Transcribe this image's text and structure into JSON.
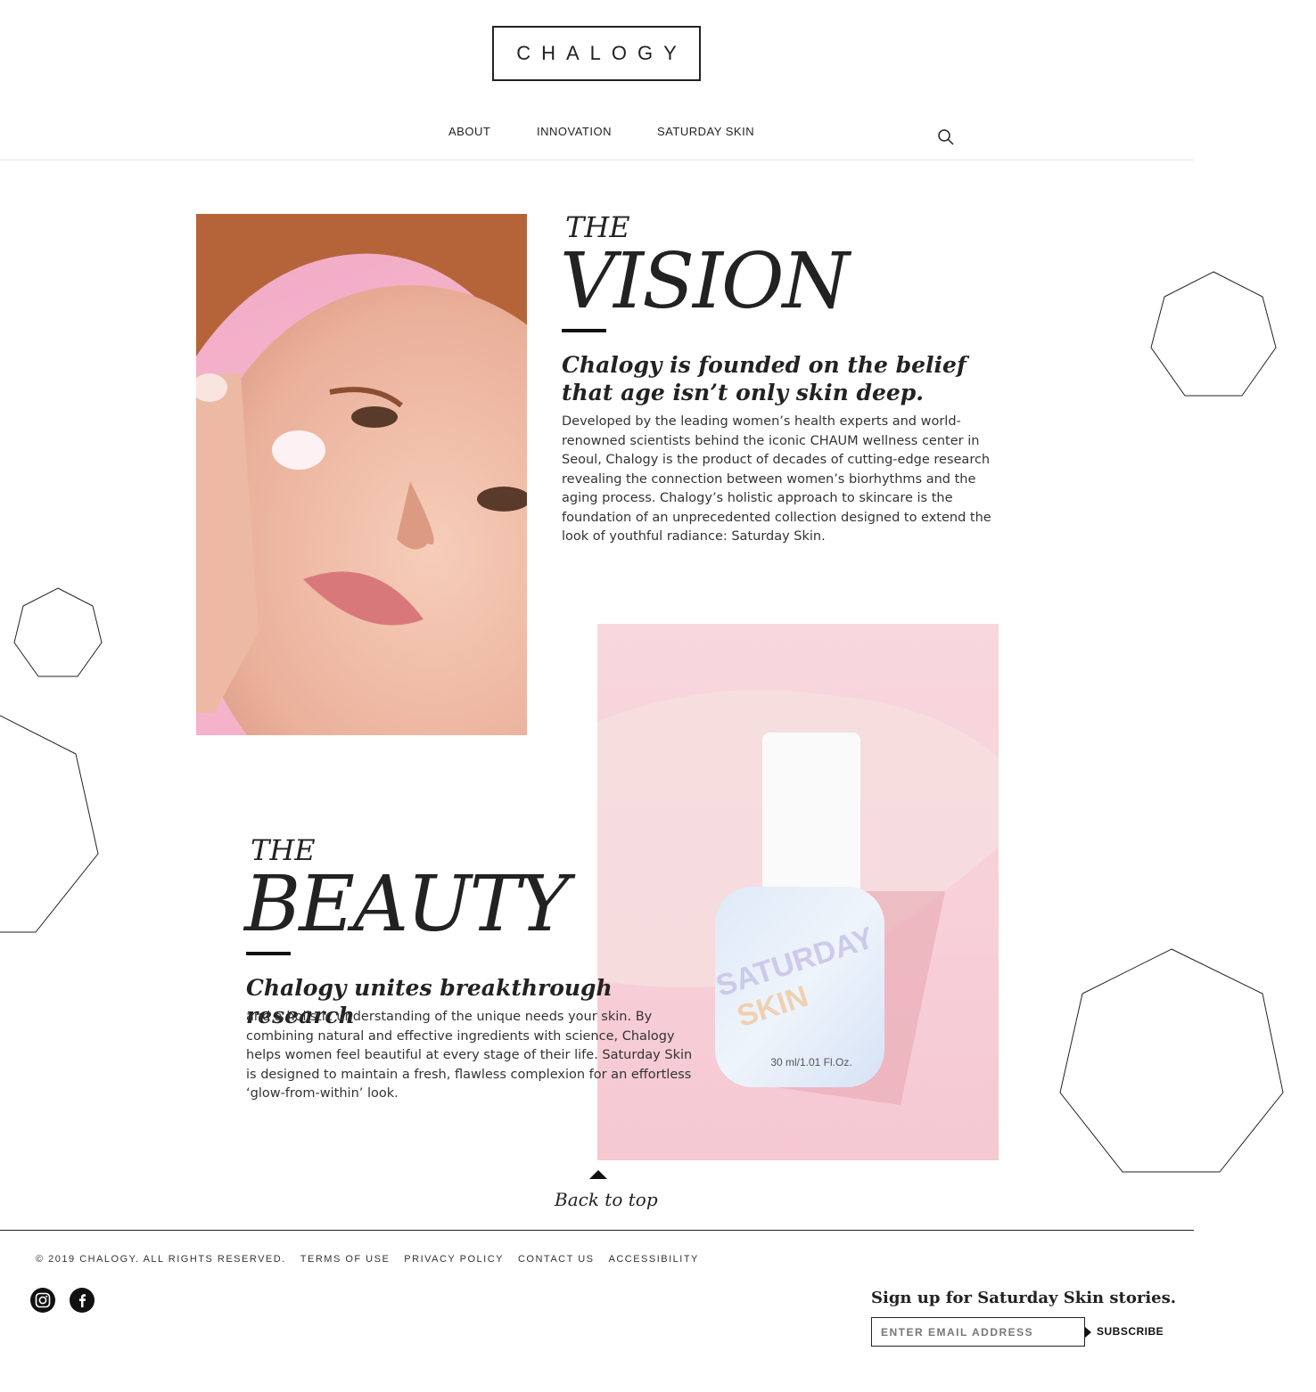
{
  "brand": {
    "logo": "CHALOGY"
  },
  "nav": {
    "items": [
      {
        "label": "ABOUT"
      },
      {
        "label": "INNOVATION"
      },
      {
        "label": "SATURDAY SKIN"
      }
    ],
    "search_icon": "search-icon"
  },
  "vision": {
    "the": "THE",
    "heading": "VISION",
    "lead": "Chalogy is founded on the belief that age isn’t only skin deep.",
    "body": "Developed by the leading women’s health experts and world-renowned scientists behind the iconic CHAUM wellness center in Seoul, Chalogy is the product of decades of cutting-edge research revealing the connection between women’s biorhythms and the aging process. Chalogy’s holistic approach to skincare is the foundation of an unprecedented collection designed to extend the look of youthful radiance: Saturday Skin."
  },
  "beauty": {
    "the": "THE",
    "heading": "BEAUTY",
    "lead": "Chalogy unites breakthrough research",
    "body": "and a holistic understanding of the unique needs your skin. By combining natural and effective ingredients with science, Chalogy helps women feel beautiful at every stage of their life. Saturday Skin is designed to maintain a fresh, flawless complexion for an effortless ‘glow-from-within’ look."
  },
  "product": {
    "brand_line1": "SATURDAY",
    "brand_line2": "SKIN",
    "volume": "30 ml/1.01 Fl.Oz."
  },
  "back_to_top": {
    "label": "Back to top"
  },
  "footer": {
    "copyright": "© 2019 CHALOGY. ALL RIGHTS RESERVED.",
    "links": [
      "TERMS OF USE",
      "PRIVACY POLICY",
      "CONTACT US",
      "ACCESSIBILITY"
    ],
    "social": [
      "instagram-icon",
      "facebook-icon"
    ],
    "signup_title": "Sign up for Saturday Skin stories.",
    "email_placeholder": "ENTER EMAIL ADDRESS",
    "subscribe_label": "SUBSCRIBE"
  },
  "colors": {
    "text": "#222222",
    "face_bg": "#f3aec8",
    "bottle_bg": "#f7d2da",
    "rule": "#111111"
  }
}
